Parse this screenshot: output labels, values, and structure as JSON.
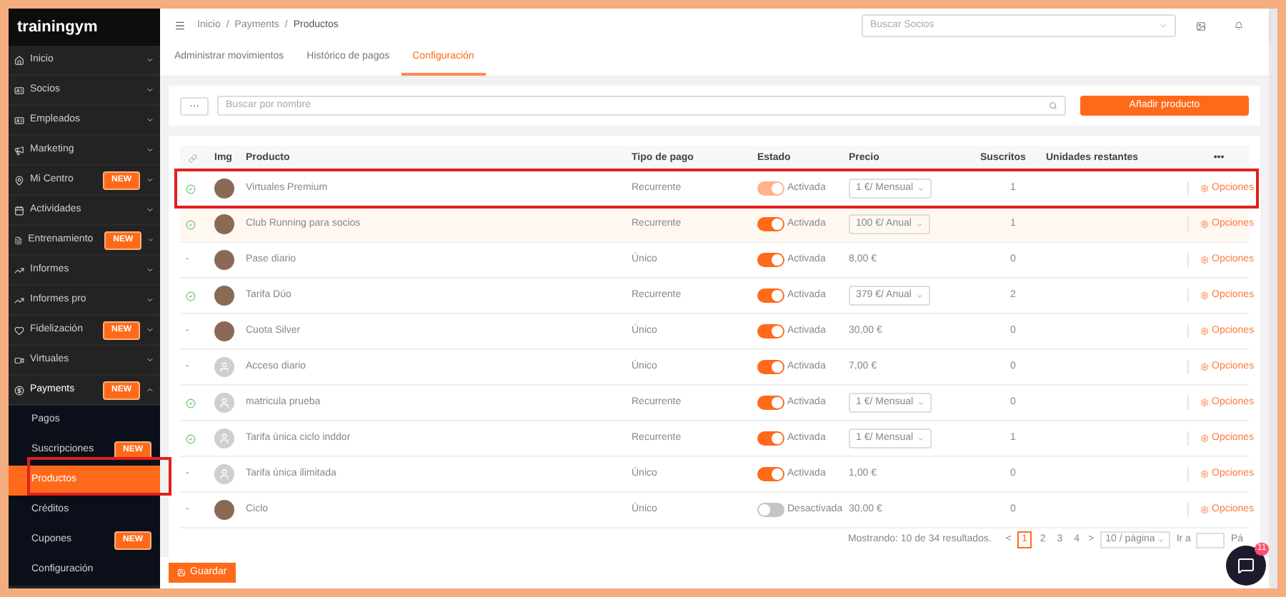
{
  "sidebar": {
    "logo": "trainingym",
    "items": [
      {
        "label": "Inicio",
        "expanded": false
      },
      {
        "label": "Socios",
        "expanded": false
      },
      {
        "label": "Empleados",
        "expanded": false
      },
      {
        "label": "Marketing",
        "expanded": false
      },
      {
        "label": "Mi Centro",
        "badge": "NEW",
        "expanded": false
      },
      {
        "label": "Actividades",
        "expanded": false
      },
      {
        "label": "Entrenamiento",
        "badge": "NEW",
        "expanded": false
      },
      {
        "label": "Informes",
        "expanded": false
      },
      {
        "label": "Informes pro",
        "expanded": false
      },
      {
        "label": "Fidelización",
        "badge": "NEW",
        "expanded": false
      },
      {
        "label": "Virtuales",
        "expanded": false
      },
      {
        "label": "Payments",
        "badge": "NEW",
        "expanded": true,
        "children": [
          {
            "label": "Pagos",
            "selected": false
          },
          {
            "label": "Suscripciones",
            "badge": "NEW",
            "selected": false
          },
          {
            "label": "Productos",
            "selected": true
          },
          {
            "label": "Créditos",
            "selected": false
          },
          {
            "label": "Cupones",
            "badge": "NEW",
            "selected": false
          },
          {
            "label": "Configuración",
            "selected": false
          }
        ]
      }
    ]
  },
  "header": {
    "breadcrumb": [
      "Inicio",
      "/",
      "Payments",
      "/",
      "Productos"
    ],
    "member_search": {
      "placeholder": "Buscar Socios"
    }
  },
  "tabs": [
    {
      "label": "Administrar movimientos",
      "selected": false
    },
    {
      "label": "Histórico de pagos",
      "selected": false
    },
    {
      "label": "Configuración",
      "selected": true
    }
  ],
  "toolbar": {
    "more_button": "···",
    "search": {
      "placeholder": "Buscar por nombre"
    },
    "add_button": "Añadir producto"
  },
  "table": {
    "columns": [
      "Img",
      "Producto",
      "Tipo de pago",
      "Estado",
      "Precio",
      "Suscritos",
      "Unidades restantes",
      "•••"
    ],
    "rows": [
      {
        "recurring": true,
        "image": {
          "kind": "photo"
        },
        "name": "Virtuales Premium",
        "payment_type": "Recurrente",
        "active": true,
        "disabled": true,
        "status": "Activada",
        "price": {
          "kind": "select",
          "text": "1 €/ Mensual"
        },
        "subscribed": "1",
        "options": "Opciones",
        "highlighted": false
      },
      {
        "recurring": true,
        "image": {
          "kind": "photo"
        },
        "name": "Club Running para socios",
        "payment_type": "Recurrente",
        "active": true,
        "disabled": false,
        "status": "Activada",
        "price": {
          "kind": "select",
          "text": "100 €/ Anual"
        },
        "subscribed": "1",
        "options": "Opciones",
        "highlighted": true
      },
      {
        "recurring": false,
        "link_mark": "-",
        "image": {
          "kind": "photo"
        },
        "name": "Pase diario",
        "payment_type": "Único",
        "active": true,
        "disabled": false,
        "status": "Activada",
        "price": {
          "kind": "text",
          "text": "8,00 €"
        },
        "subscribed": "0",
        "options": "Opciones",
        "highlighted": false
      },
      {
        "recurring": true,
        "image": {
          "kind": "photo"
        },
        "name": "Tarifa Dúo",
        "payment_type": "Recurrente",
        "active": true,
        "disabled": false,
        "status": "Activada",
        "price": {
          "kind": "select",
          "text": "379 €/ Anual"
        },
        "subscribed": "2",
        "options": "Opciones",
        "highlighted": false
      },
      {
        "recurring": false,
        "link_mark": "-",
        "image": {
          "kind": "photo"
        },
        "name": "Cuota Silver",
        "payment_type": "Único",
        "active": true,
        "disabled": false,
        "status": "Activada",
        "price": {
          "kind": "text",
          "text": "30,00 €"
        },
        "subscribed": "0",
        "options": "Opciones",
        "highlighted": false
      },
      {
        "recurring": false,
        "link_mark": "-",
        "image": {
          "kind": "avatar"
        },
        "name": "Acceso diario",
        "payment_type": "Único",
        "active": true,
        "disabled": false,
        "status": "Activada",
        "price": {
          "kind": "text",
          "text": "7,00 €"
        },
        "subscribed": "0",
        "options": "Opciones",
        "highlighted": false
      },
      {
        "recurring": true,
        "image": {
          "kind": "avatar"
        },
        "name": "matricula prueba",
        "payment_type": "Recurrente",
        "active": true,
        "disabled": false,
        "status": "Activada",
        "price": {
          "kind": "select",
          "text": "1 €/ Mensual"
        },
        "subscribed": "0",
        "options": "Opciones",
        "highlighted": false
      },
      {
        "recurring": true,
        "image": {
          "kind": "avatar"
        },
        "name": "Tarifa única ciclo inddor",
        "payment_type": "Recurrente",
        "active": true,
        "disabled": false,
        "status": "Activada",
        "price": {
          "kind": "select",
          "text": "1 €/ Mensual"
        },
        "subscribed": "1",
        "options": "Opciones",
        "highlighted": false
      },
      {
        "recurring": false,
        "link_mark": "-",
        "image": {
          "kind": "avatar"
        },
        "name": "Tarifa única ilimitada",
        "payment_type": "Único",
        "active": true,
        "disabled": false,
        "status": "Activada",
        "price": {
          "kind": "text",
          "text": "1,00 €"
        },
        "subscribed": "0",
        "options": "Opciones",
        "highlighted": false
      },
      {
        "recurring": false,
        "link_mark": "-",
        "image": {
          "kind": "photo"
        },
        "name": "Ciclo",
        "payment_type": "Único",
        "active": false,
        "disabled": false,
        "status": "Desactivada",
        "price": {
          "kind": "text",
          "text": "30,00 €"
        },
        "subscribed": "0",
        "options": "Opciones",
        "highlighted": false
      }
    ]
  },
  "pagination": {
    "summary": "Mostrando: 10 de 34 resultados.",
    "prev": "<",
    "pages": [
      {
        "label": "1",
        "selected": true
      },
      {
        "label": "2",
        "selected": false
      },
      {
        "label": "3",
        "selected": false
      },
      {
        "label": "4",
        "selected": false
      }
    ],
    "next": ">",
    "page_size": "10 / página",
    "goto": "Ir a",
    "page_label": "Pá"
  },
  "footer": {
    "save_button": "Guardar"
  },
  "chat": {
    "badge": "11"
  }
}
